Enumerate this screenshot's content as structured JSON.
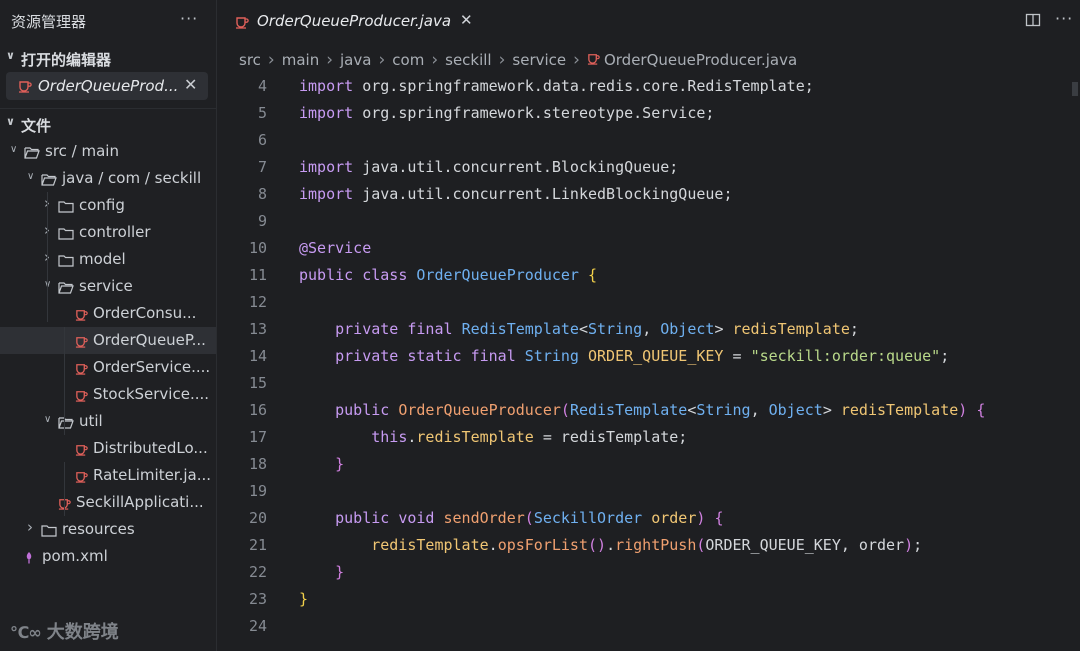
{
  "sidebar": {
    "title": "资源管理器",
    "more_label": "···",
    "open_editors_label": "打开的编辑器",
    "open_editor_file": "OrderQueueProd...",
    "open_editor_close": "✕",
    "files_label": "文件",
    "tree": [
      {
        "label": "src / main",
        "kind": "folder",
        "expanded": true
      },
      {
        "label": "java / com / seckill",
        "kind": "folder",
        "expanded": true
      },
      {
        "label": "config",
        "kind": "folder",
        "expanded": false
      },
      {
        "label": "controller",
        "kind": "folder",
        "expanded": false
      },
      {
        "label": "model",
        "kind": "folder",
        "expanded": false
      },
      {
        "label": "service",
        "kind": "folder",
        "expanded": true
      },
      {
        "label": "OrderConsu...",
        "kind": "java"
      },
      {
        "label": "OrderQueueP...",
        "kind": "java",
        "selected": true
      },
      {
        "label": "OrderService....",
        "kind": "java"
      },
      {
        "label": "StockService....",
        "kind": "java"
      },
      {
        "label": "util",
        "kind": "folder",
        "expanded": true
      },
      {
        "label": "DistributedLo...",
        "kind": "java"
      },
      {
        "label": "RateLimiter.ja...",
        "kind": "java"
      },
      {
        "label": "SeckillApplicati...",
        "kind": "java"
      },
      {
        "label": "resources",
        "kind": "folder",
        "expanded": false
      },
      {
        "label": "pom.xml",
        "kind": "xml"
      }
    ],
    "watermark": "大数跨境"
  },
  "editor": {
    "tab": {
      "label": "OrderQueueProducer.java",
      "close": "✕"
    },
    "more_label": "···",
    "breadcrumb": [
      "src",
      "main",
      "java",
      "com",
      "seckill",
      "service",
      "OrderQueueProducer.java"
    ],
    "lines": [
      {
        "n": "4",
        "code": "import org.springframework.data.redis.core.RedisTemplate;"
      },
      {
        "n": "5",
        "code": "import org.springframework.stereotype.Service;"
      },
      {
        "n": "6",
        "code": ""
      },
      {
        "n": "7",
        "code": "import java.util.concurrent.BlockingQueue;"
      },
      {
        "n": "8",
        "code": "import java.util.concurrent.LinkedBlockingQueue;"
      },
      {
        "n": "9",
        "code": ""
      },
      {
        "n": "10",
        "code": "@Service"
      },
      {
        "n": "11",
        "code": "public class OrderQueueProducer {"
      },
      {
        "n": "12",
        "code": ""
      },
      {
        "n": "13",
        "code": "    private final RedisTemplate<String, Object> redisTemplate;"
      },
      {
        "n": "14",
        "code": "    private static final String ORDER_QUEUE_KEY = \"seckill:order:queue\";"
      },
      {
        "n": "15",
        "code": ""
      },
      {
        "n": "16",
        "code": "    public OrderQueueProducer(RedisTemplate<String, Object> redisTemplate) {"
      },
      {
        "n": "17",
        "code": "        this.redisTemplate = redisTemplate;"
      },
      {
        "n": "18",
        "code": "    }"
      },
      {
        "n": "19",
        "code": ""
      },
      {
        "n": "20",
        "code": "    public void sendOrder(SeckillOrder order) {"
      },
      {
        "n": "21",
        "code": "        redisTemplate.opsForList().rightPush(ORDER_QUEUE_KEY, order);"
      },
      {
        "n": "22",
        "code": "    }"
      },
      {
        "n": "23",
        "code": "}"
      },
      {
        "n": "24",
        "code": ""
      }
    ]
  }
}
